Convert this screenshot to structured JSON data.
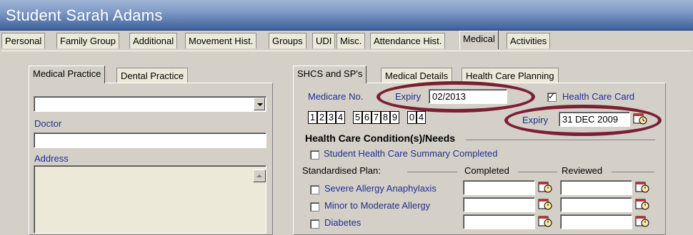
{
  "window": {
    "title": "Student Sarah Adams"
  },
  "tabs": [
    "Personal",
    "Family Group",
    "Additional",
    "Movement Hist.",
    "Groups",
    "UDI",
    "Misc.",
    "Attendance Hist.",
    "Medical",
    "Activities"
  ],
  "active_tab": "Medical",
  "left_panel": {
    "tabs": [
      "Medical Practice",
      "Dental Practice"
    ],
    "active_tab": "Medical Practice",
    "combo_value": "",
    "doctor_label": "Doctor",
    "doctor_value": "",
    "address_label": "Address",
    "address_value": ""
  },
  "right_panel": {
    "tabs": [
      "SHCS and SP's",
      "Medical Details",
      "Health Care Planning"
    ],
    "active_tab": "SHCS and SP's",
    "medicare_label": "Medicare No.",
    "expiry_label": "Expiry",
    "medicare_expiry": "02/2013",
    "health_care_card_label": "Health Care Card",
    "health_care_card_checked": true,
    "medicare_digits": [
      "1",
      "2",
      "3",
      "4",
      "5",
      "6",
      "7",
      "8",
      "9",
      "0",
      "4"
    ],
    "hcc_expiry_label": "Expiry",
    "hcc_expiry": "31 DEC 2009",
    "section_title": "Health Care Condition(s)/Needs",
    "summary_label": "Student Health Care Summary Completed",
    "standardised_plan_label": "Standardised Plan:",
    "completed_label": "Completed",
    "reviewed_label": "Reviewed",
    "plans": [
      {
        "label": "Severe Allergy Anaphylaxis",
        "completed": "",
        "reviewed": ""
      },
      {
        "label": "Minor to Moderate Allergy",
        "completed": "",
        "reviewed": ""
      },
      {
        "label": "Diabetes",
        "completed": "",
        "reviewed": ""
      }
    ]
  },
  "colors": {
    "title_bar": "#3d5f9a",
    "label_blue": "#1f2f8f",
    "highlight_ellipse": "#7a2032"
  }
}
